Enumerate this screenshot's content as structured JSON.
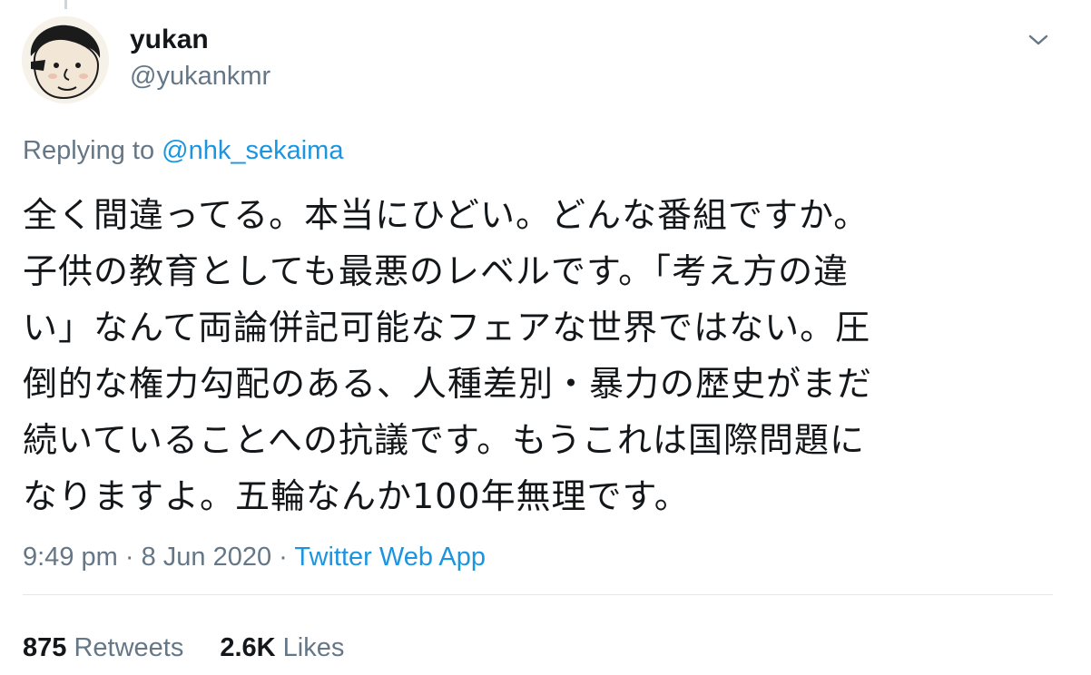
{
  "author": {
    "name": "yukan",
    "handle": "@yukankmr"
  },
  "reply": {
    "prefix": "Replying to",
    "mention": "@nhk_sekaima"
  },
  "tweet": {
    "text": "全く間違ってる。本当にひどい。どんな番組ですか。\n子供の教育としても最悪のレベルです。「考え方の違\nい」なんて両論併記可能なフェアな世界ではない。圧\n倒的な権力勾配のある、人種差別・暴力の歴史がまだ\n続いていることへの抗議です。もうこれは国際問題に\nなりますよ。五輪なんか100年無理です。"
  },
  "meta": {
    "time": "9:49 pm",
    "separator1": "·",
    "date": "8 Jun 2020",
    "separator2": "·",
    "source": "Twitter Web App"
  },
  "stats": {
    "retweets_count": "875",
    "retweets_label": "Retweets",
    "likes_count": "2.6K",
    "likes_label": "Likes"
  },
  "icons": {
    "caret": "chevron-down-icon",
    "avatar": "avatar-illustration"
  },
  "colors": {
    "text_primary": "#14171a",
    "text_secondary": "#657786",
    "link": "#1b95e0",
    "divider": "#e1e8ed"
  }
}
